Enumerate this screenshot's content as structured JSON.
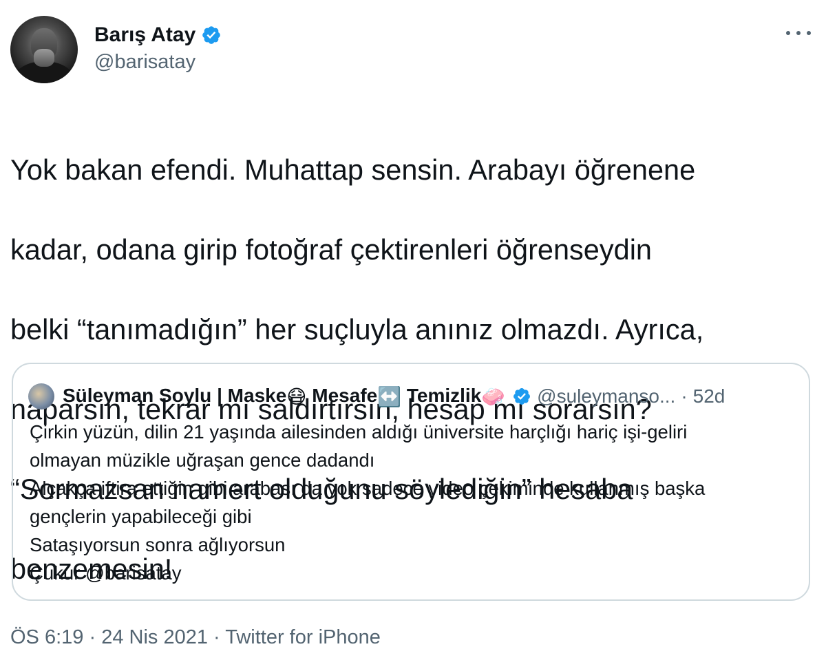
{
  "author": {
    "display_name": "Barış Atay",
    "handle": "@barisatay",
    "verified": true,
    "avatar_icon": "profile-photo"
  },
  "tweet": {
    "text_lines": [
      "Yok bakan efendi. Muhattap sensin. Arabayı öğrenene",
      "kadar, odana girip fotoğraf çektirenleri öğrenseydin",
      "belki “tanımadığın” her suçluyla anınız olmazdı. Ayrıca,",
      "naparsın, tekrar mı saldırtırsın, hesap mı sorarsın?",
      "“Sormazsan namert olduğunu söylediğin” hesaba",
      "benzemesin!"
    ],
    "time": "ÖS 6:19",
    "date": "24 Nis 2021",
    "source": "Twitter for iPhone"
  },
  "quoted_tweet": {
    "name_part1": "Süleyman Soylu | Maske",
    "emoji1": "😷",
    "name_part2": " Mesafe",
    "emoji2": "↔️",
    "name_part3": " Temizlik",
    "emoji3": "🧼",
    "handle": "@suleymanso...",
    "separator": "·",
    "age": "52d",
    "verified": true,
    "lines": [
      "Çirkin yüzün, dilin 21 yaşında ailesinden aldığı üniversite harçlığı hariç işi-geliri",
      "olmayan müzikle uğraşan gence dadandı",
      "Alçakça iftira ettiğin gibi arabası da yok sadece video çekiminde kullanmış başka",
      "gençlerin yapabileceği gibi",
      "Sataşıyorsun sonra ağlıyorsun",
      "Çukur @barisatay"
    ]
  },
  "meta_separator": " · ",
  "colors": {
    "verified_blue": "#1d9bf0",
    "secondary_text": "#536471",
    "border": "#cfd9de"
  }
}
